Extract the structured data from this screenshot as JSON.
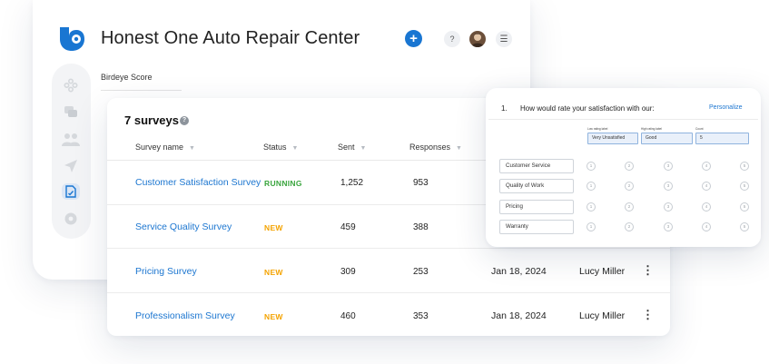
{
  "header": {
    "title": "Honest One Auto Repair Center",
    "plus_icon": "plus-icon",
    "help_icon": "help-icon",
    "menu_icon": "menu-icon"
  },
  "breadcrumb": "Birdeye Score",
  "sidebar": {
    "icons": [
      "widgets-icon",
      "chat-icon",
      "people-icon",
      "send-icon",
      "surveys-icon",
      "settings-icon"
    ],
    "active": "surveys-icon"
  },
  "surveys": {
    "count_label": "7 surveys",
    "columns": [
      "Survey name",
      "Status",
      "Sent",
      "Responses"
    ],
    "rows": [
      {
        "name": "Customer Satisfaction Survey",
        "status": "RUNNING",
        "sent": "1,252",
        "responses": "953",
        "date": "",
        "owner": ""
      },
      {
        "name": "Service Quality Survey",
        "status": "NEW",
        "sent": "459",
        "responses": "388",
        "date": "",
        "owner": ""
      },
      {
        "name": "Pricing Survey",
        "status": "NEW",
        "sent": "309",
        "responses": "253",
        "date": "Jan 18, 2024",
        "owner": "Lucy Miller"
      },
      {
        "name": "Professionalism Survey",
        "status": "NEW",
        "sent": "460",
        "responses": "353",
        "date": "Jan 18, 2024",
        "owner": "Lucy Miller"
      }
    ]
  },
  "question": {
    "number": "1.",
    "text": "How would rate your satisfaction with our:",
    "personalize": "Personalize",
    "low_label": "Low rating label",
    "high_label": "High rating label",
    "count_label": "Count",
    "low_value": "Very Unsatisfied",
    "high_value": "Good",
    "count_value": "5",
    "items": [
      "Customer Service",
      "Quality of Work",
      "Pricing",
      "Warranty"
    ],
    "scale": [
      "1",
      "2",
      "3",
      "4",
      "5"
    ]
  },
  "colors": {
    "accent": "#1976d2",
    "running": "#3aa53e",
    "new": "#f4a300",
    "link": "#1c76d0"
  }
}
